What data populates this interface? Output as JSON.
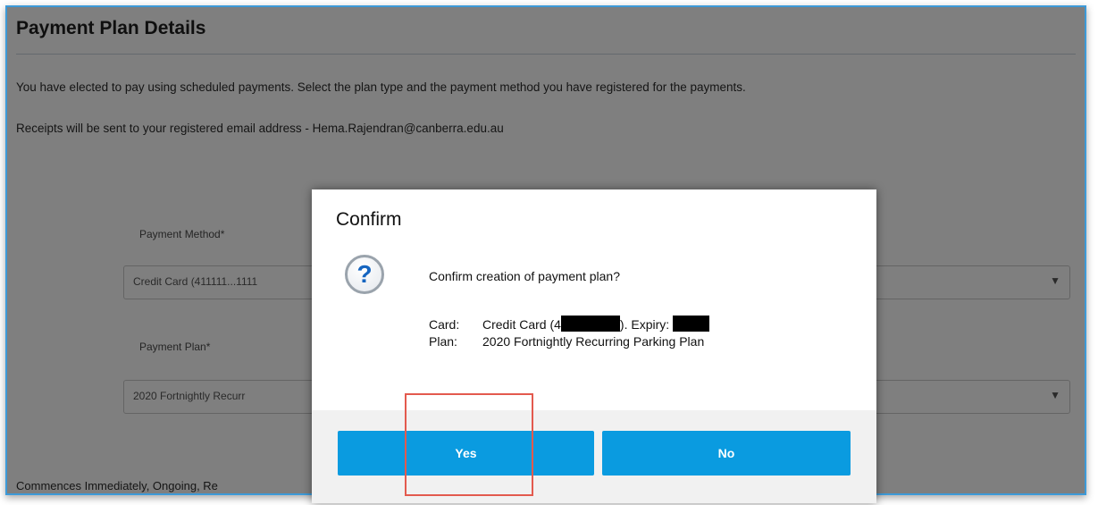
{
  "page": {
    "title": "Payment Plan Details",
    "description": "You have elected to pay using scheduled payments. Select the plan type and the payment method you have registered for the payments.",
    "receipts": "Receipts will be sent to your registered email address - Hema.Rajendran@canberra.edu.au",
    "payment_method_label": "Payment Method*",
    "payment_method_value": "Credit Card (411111...1111",
    "payment_plan_label": "Payment Plan*",
    "payment_plan_value": "2020 Fortnightly Recurr",
    "commences": "Commences Immediately, Ongoing, Re"
  },
  "dialog": {
    "title": "Confirm",
    "icon": "question-icon",
    "message": "Confirm creation of payment plan?",
    "card_label": "Card:",
    "card_value_prefix": "Credit Card (4",
    "card_value_mid": ").  Expiry:",
    "plan_label": "Plan:",
    "plan_value": "2020 Fortnightly Recurring Parking Plan",
    "yes_label": "Yes",
    "no_label": "No"
  },
  "colors": {
    "accent_blue": "#0a9be0",
    "highlight_red": "#e35a4e",
    "frame_border": "#3d9ad8"
  }
}
